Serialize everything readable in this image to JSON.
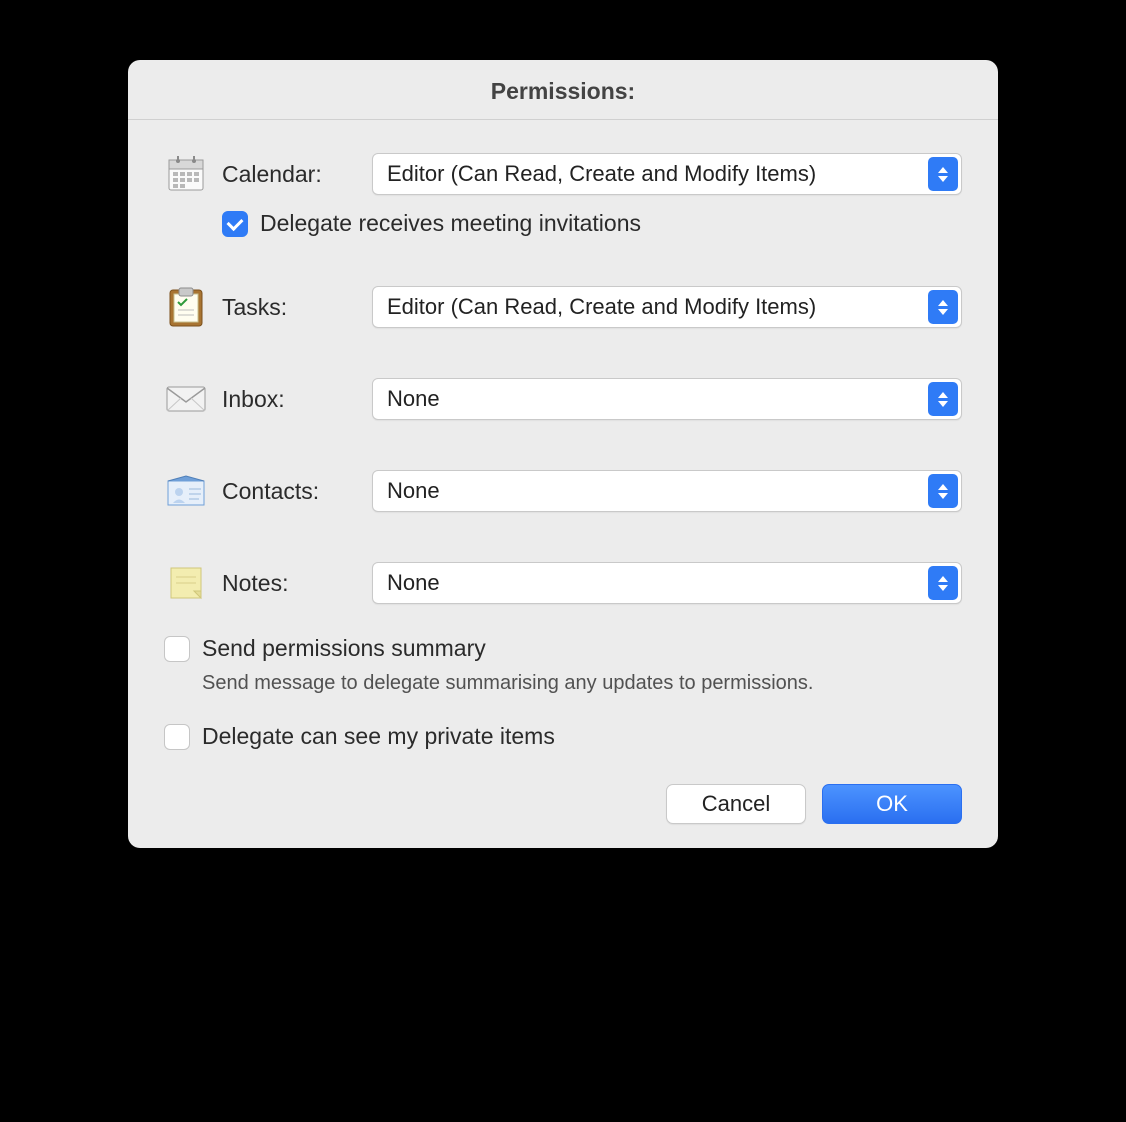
{
  "dialog": {
    "title": "Permissions:"
  },
  "rows": {
    "calendar": {
      "label": "Calendar:",
      "value": "Editor (Can Read, Create and Modify Items)"
    },
    "tasks": {
      "label": "Tasks:",
      "value": "Editor (Can Read, Create and Modify Items)"
    },
    "inbox": {
      "label": "Inbox:",
      "value": "None"
    },
    "contacts": {
      "label": "Contacts:",
      "value": "None"
    },
    "notes": {
      "label": "Notes:",
      "value": "None"
    }
  },
  "checks": {
    "delegate_meetings": {
      "label": "Delegate receives meeting invitations",
      "checked": true
    },
    "send_summary": {
      "label": "Send permissions summary",
      "checked": false,
      "desc": "Send message to delegate summarising any updates to permissions."
    },
    "private_items": {
      "label": "Delegate can see my private items",
      "checked": false
    }
  },
  "buttons": {
    "cancel": "Cancel",
    "ok": "OK"
  }
}
